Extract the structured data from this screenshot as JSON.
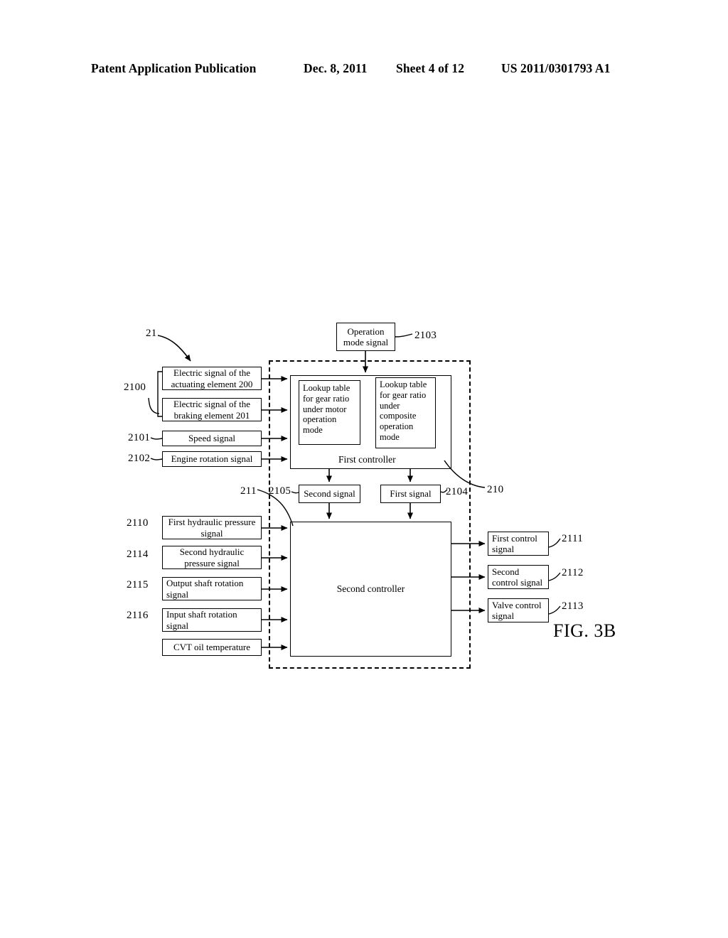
{
  "header": {
    "publication": "Patent Application Publication",
    "date": "Dec. 8, 2011",
    "sheet": "Sheet 4 of 12",
    "number": "US 2011/0301793 A1"
  },
  "figure": {
    "label": "FIG. 3B",
    "system_ref": "21",
    "first_controller_ref": "210",
    "second_controller_ref": "211"
  },
  "inputs_top": {
    "group_ref": "2100",
    "items": [
      {
        "ref": "",
        "label": "Electric signal of the actuating element 200"
      },
      {
        "ref": "",
        "label": "Electric signal of the braking element 201"
      },
      {
        "ref": "2101",
        "label": "Speed signal"
      },
      {
        "ref": "2102",
        "label": "Engine rotation signal"
      }
    ]
  },
  "operation_mode": {
    "ref": "2103",
    "label": "Operation mode signal"
  },
  "first_controller": {
    "title": "First controller",
    "lookup_tables": [
      {
        "label": "Lookup table for gear ratio under motor operation mode"
      },
      {
        "label": "Lookup table for gear ratio under composite operation mode"
      }
    ]
  },
  "intermediate_signals": [
    {
      "ref": "2105",
      "label": "Second signal"
    },
    {
      "ref": "2104",
      "label": "First signal"
    }
  ],
  "second_controller": {
    "title": "Second controller"
  },
  "inputs_bottom": [
    {
      "ref": "2110",
      "label": "First hydraulic pressure signal"
    },
    {
      "ref": "2114",
      "label": "Second hydraulic pressure signal"
    },
    {
      "ref": "2115",
      "label": "Output shaft rotation signal"
    },
    {
      "ref": "2116",
      "label": "Input shaft rotation signal"
    },
    {
      "ref": "",
      "label": "CVT oil temperature"
    }
  ],
  "outputs": [
    {
      "ref": "2111",
      "label": "First control signal"
    },
    {
      "ref": "2112",
      "label": "Second control signal"
    },
    {
      "ref": "2113",
      "label": "Valve control signal"
    }
  ]
}
